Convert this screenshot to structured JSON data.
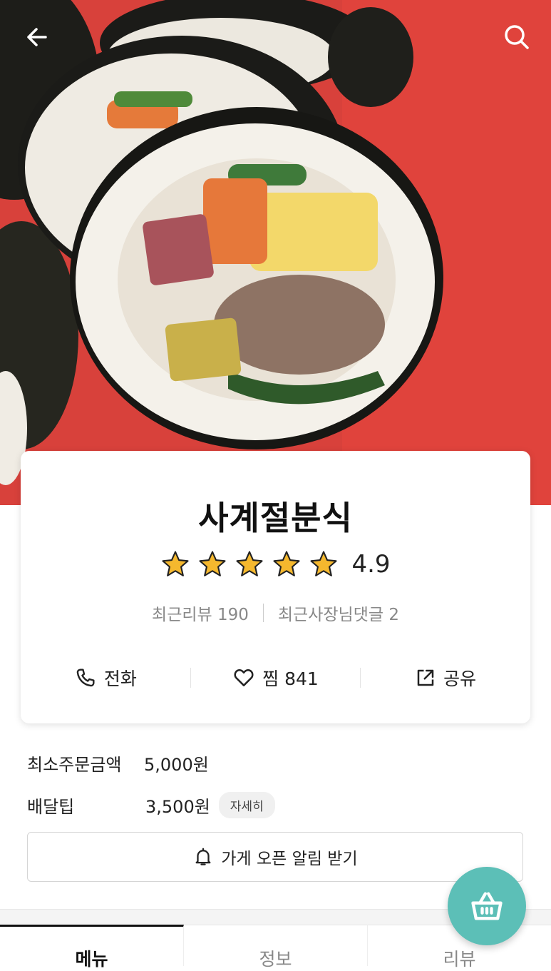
{
  "header": {
    "back_icon": "arrow-left-icon",
    "search_icon": "search-icon"
  },
  "store": {
    "name": "사계절분식",
    "rating": "4.9",
    "stars": 5,
    "recent_reviews_label": "최근리뷰 190",
    "recent_owner_comments_label": "최근사장님댓글 2"
  },
  "actions": {
    "call_label": "전화",
    "favorite_label": "찜",
    "favorite_count": "841",
    "share_label": "공유"
  },
  "info": {
    "min_order_label": "최소주문금액",
    "min_order_value": "5,000원",
    "delivery_tip_label": "배달팁",
    "delivery_tip_value": "3,500원",
    "detail_button": "자세히"
  },
  "notify_button": "가게 오픈 알림 받기",
  "tabs": [
    {
      "label": "메뉴",
      "active": true
    },
    {
      "label": "정보",
      "active": false
    },
    {
      "label": "리뷰",
      "active": false
    }
  ],
  "colors": {
    "accent": "#5cbfb7",
    "star": "#f5b82e"
  }
}
